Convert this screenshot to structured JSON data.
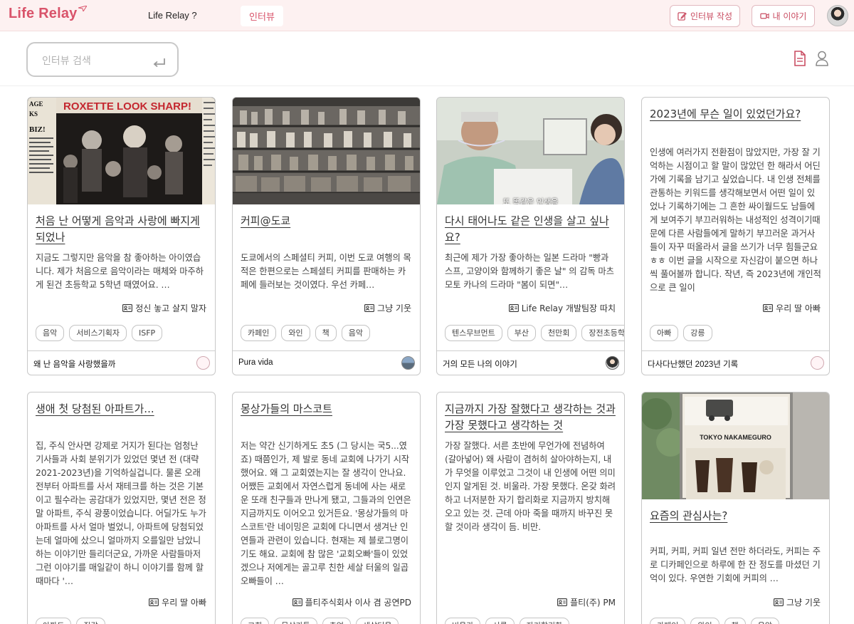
{
  "header": {
    "logo": "Life Relay",
    "nav_about": "Life Relay ?",
    "nav_interview": "인터뷰",
    "write_button": "인터뷰 작성",
    "my_story_button": "내 이야기"
  },
  "search": {
    "placeholder": "인터뷰 검색"
  },
  "cards": [
    {
      "title": "처음 난 어떻게 음악과 사랑에 빠지게 되었나",
      "excerpt": "지금도 그렇지만 음악을 참 좋아하는 아이였습니다. 제가 처음으로 음악이라는 매체와 마주하게 된건 초등학교 5학년 때였어요. …",
      "author": "정신 놓고 살지 말자",
      "tags": [
        "음악",
        "서비스기획자",
        "ISFP"
      ],
      "series": "왜 난 음악을 사랑했을까",
      "image": "concert-poster"
    },
    {
      "title": "커피@도쿄",
      "excerpt": "도쿄에서의 스페셜티 커피, 이번 도쿄 여행의 목적은 한편으로는 스페셜티 커피를 판매하는 카페에 들러보는 것이였다. 우선 카페…",
      "author": "그냥 기웃",
      "tags": [
        "카페인",
        "와인",
        "책",
        "음악"
      ],
      "series": "Pura vida",
      "image": "coffee-shelf"
    },
    {
      "title": "다시 태어나도 같은 인생을 살고 싶나요?",
      "excerpt": "최근에 제가 가장 좋아하는 일본 드라마 \"빵과 스프, 고양이와 함께하기 좋은 날\" 의 감독 마츠모토 카나의 드라마 \"봄이 되면\"…",
      "author": "Life Relay 개발팀장 따치",
      "tags": [
        "텐스무브먼트",
        "부산",
        "천만회",
        "장전초등학"
      ],
      "series": "거의 모든 나의 이야기",
      "image": "drama-scene",
      "image_caption": "또 똑같은 인생을"
    },
    {
      "title": "2023년에 무슨 일이 있었던가요?",
      "excerpt": "인생에 여러가지 전환점이 많았지만, 가장 잘 기억하는 시점이고 할 말이 많았던 한 해라서 어딘가에 기록을 남기고 싶었습니다. 내 인생 전체를 관통하는 키워드를 생각해보면서 어떤 일이 있었나 기록하기에는 그 흔한 싸이월드도 남들에게 보여주기 부끄러워하는 내성적인 성격이기때문에 다른 사람들에게 말하기 부끄러운 과거사들이 자꾸 떠올라서 글을 쓰기가 너무 힘들군요 ㅎㅎ 이번 글을 시작으로 자신감이 붙으면 하나씩 풀어볼까 합니다. 작년, 즉 2023년에 개인적으로 큰 일이",
      "author": "우리 딸 아빠",
      "tags": [
        "아빠",
        "강릉"
      ],
      "series": "다사다난했던 2023년 기록"
    },
    {
      "title": "생애 첫 당첨된 아파트가...",
      "excerpt": "집, 주식 안사면 강제로 거지가 된다는 엄청난 기사들과 사회 분위기가 있었던 몇년 전 (대략 2021-2023년)을 기억하실겁니다. 물론 오래 전부터 아파트를 사서 재테크를 하는 것은 기본이고 필수라는 공감대가 있었지만, 몇년 전은 정말 아파트, 주식 광풍이었습니다. 어딜가도 누가 아파트를 사서 얼마 벌었니, 아파트에 당첨되었는데 얼마에 샀으니 얼마까지 오를일만 남았니 하는 이야기만 들리더군요, 가까운 사람들마저 그런 이야기를 매일같이 하니 이야기를 함께 할때마다 '…",
      "author": "우리 딸 아빠",
      "tags": [
        "아파트",
        "집값"
      ]
    },
    {
      "title": "몽상가들의 마스코트",
      "excerpt": "저는 약간 신기하게도 초5 (그 당시는 국5...였죠) 때쯤인가, 제 발로 동네 교회에 나가기 시작했어요. 왜 그 교회였는지는 잘 생각이 안나요. 어쨌든 교회에서 자연스럽게 동네에 사는 새로운 또래 친구들과 만나게 됐고, 그들과의 인연은 지금까지도 이어오고 있거든요. '몽상가들의 마스코트'란 네이밍은 교회에 다니면서 생겨난 인연들과 관련이 있습니다. 현재는 제 블로그명이기도 해요. 교회에 참 많은 '교회오빠'들이 있었겠으나 저에게는 골고루 친한 세살 터울의 일곱 오빠들이 …",
      "author": "플티주식회사 이사 겸 공연PD",
      "tags": [
        "교회",
        "몽상가들",
        "추억",
        "세살터울"
      ]
    },
    {
      "title": "지금까지 가장 잘했다고 생각하는 것과 가장 못했다고 생각하는 것",
      "excerpt": "가장 잘했다. 서른 초반에 무언가에 전념하여 (갈아넣어) 왜 사람이 겸허히 살아야하는지, 내가 무엇을 이루었고 그것이 내 인생에 어떤 의미인지 알게된 것. 비울라. 가장 못했다. 온갖 화려하고 너저분한 자기 합리화로 지금까지 방치해 오고 있는 것. 근데 아마 죽을 때까지 바꾸진 못할 것이라 생각이 듬. 비만.",
      "author": "플티(주) PM",
      "tags": [
        "비울라",
        "서른",
        "자기합리화"
      ]
    },
    {
      "title": "요즘의 관심사는?",
      "excerpt": "커피, 커피, 커피 일년 전만 하더라도, 커피는 주로 디카페인으로 하루에 한 잔 정도를 마셨던 기억이 있다. 우연한 기회에 커피의 …",
      "author": "그냥 기웃",
      "tags": [
        "카페인",
        "와인",
        "책",
        "음악"
      ],
      "image": "coffee-sign",
      "image_caption": "TOKYO NAKAMEGURO"
    }
  ],
  "colors": {
    "brand": "#d9536a",
    "header_bg": "#fdf1f1"
  }
}
